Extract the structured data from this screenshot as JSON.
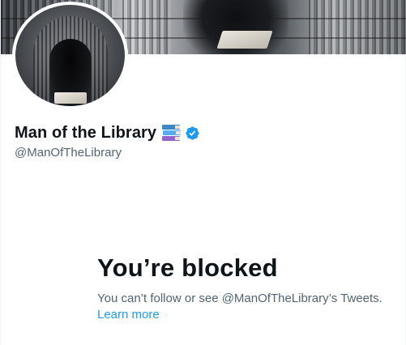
{
  "profile": {
    "display_name": "Man of the Library",
    "name_emoji": "books-emoji",
    "verified_icon": "verified-badge-icon",
    "handle": "@ManOfTheLibrary"
  },
  "blocked": {
    "title": "You’re blocked",
    "message": "You can’t follow or see @ManOfTheLibrary’s Tweets.",
    "link": "Learn more"
  },
  "colors": {
    "text_primary": "#0f1419",
    "text_secondary": "#536471",
    "link": "#1d9bf0",
    "verified": "#1d9bf0"
  }
}
